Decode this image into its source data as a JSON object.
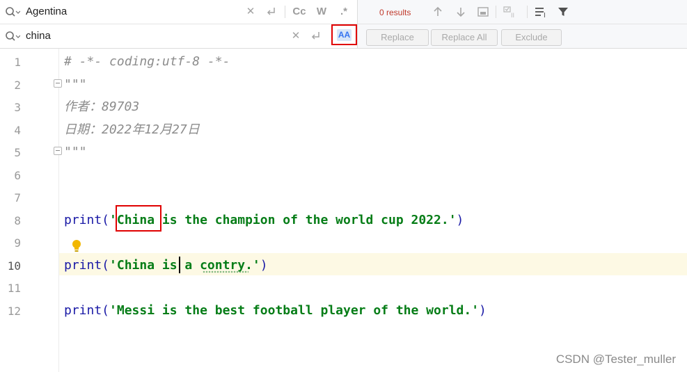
{
  "find_bar": {
    "search_text": "Agentina",
    "toggle_case_label": "Cc",
    "toggle_words_label": "W",
    "toggle_regex_label": ".*",
    "results_text": "0 results"
  },
  "replace_bar": {
    "replace_text": "china",
    "preserve_case_label": "AA",
    "replace_label": "Replace",
    "replace_all_label": "Replace All",
    "exclude_label": "Exclude"
  },
  "editor": {
    "current_line": 10,
    "lines": [
      {
        "num": "1",
        "text": "# -*- coding:utf-8 -*-"
      },
      {
        "num": "2",
        "text": "\"\"\""
      },
      {
        "num": "3",
        "text": "作者：89703"
      },
      {
        "num": "4",
        "text": "日期：2022年12月27日"
      },
      {
        "num": "5",
        "text": "\"\"\""
      },
      {
        "num": "6",
        "text": ""
      },
      {
        "num": "7",
        "text": ""
      },
      {
        "num": "8",
        "fn": "print(",
        "str": "'China is the champion of the world cup 2022.'",
        "close": ")"
      },
      {
        "num": "9",
        "text": ""
      },
      {
        "num": "10",
        "fn": "print(",
        "str": "'China is a contry.'",
        "close": ")"
      },
      {
        "num": "11",
        "text": ""
      },
      {
        "num": "12",
        "fn": "print(",
        "str": "'Messi is the best football player of the world.'",
        "close": ")"
      }
    ]
  },
  "watermark": "CSDN @Tester_muller",
  "colors": {
    "highlight_border": "#e00000",
    "results_text": "#c0392b",
    "string_literal": "#067d17",
    "function_name": "#1a1aa6"
  }
}
